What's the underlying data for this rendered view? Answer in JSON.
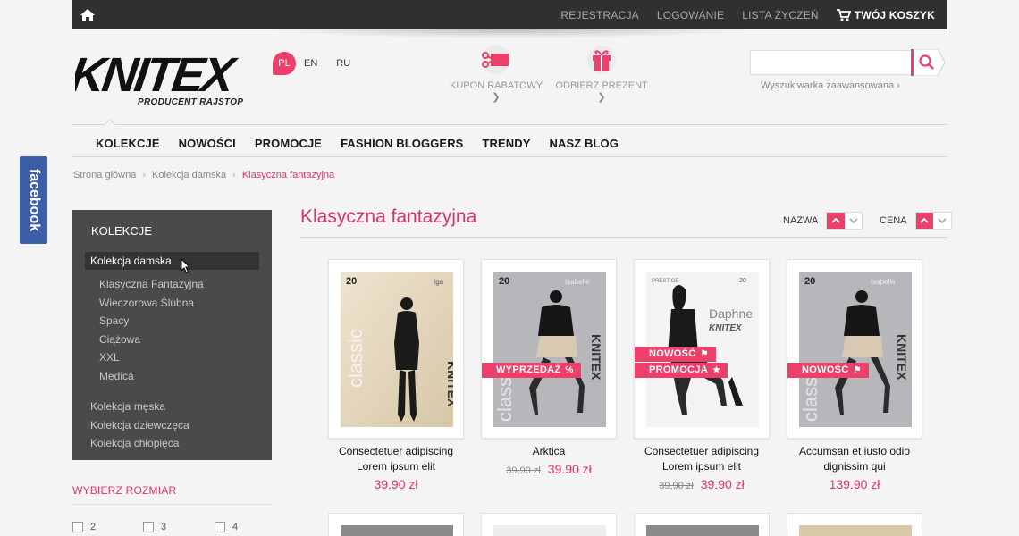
{
  "topbar": {
    "links": [
      "REJESTRACJA",
      "LOGOWANIE",
      "LISTA ŻYCZEŃ"
    ],
    "cart_label": "TWÓJ KOSZYK",
    "icons": {
      "home": "home-icon",
      "cart": "cart-icon"
    }
  },
  "header": {
    "logo_text": "KNITEX",
    "logo_sub": "PRODUCENT RAJSTOP",
    "languages": {
      "active": "PL",
      "others": [
        "EN",
        "RU"
      ]
    },
    "promos": {
      "coupon": "KUPON RABATOWY",
      "gift": "ODBIERZ PREZENT"
    },
    "search": {
      "value": "",
      "placeholder": "",
      "advanced": "Wyszukiwarka zaawansowana ›"
    }
  },
  "nav": [
    "KOLEKCJE",
    "NOWOŚCI",
    "PROMOCJE",
    "FASHION BLOGGERS",
    "TRENDY",
    "NASZ BLOG"
  ],
  "facebook_tab": "facebook",
  "breadcrumb": {
    "items": [
      "Strona główna",
      "Kolekcja damska"
    ],
    "current": "Klasyczna fantazyjna"
  },
  "sidebar": {
    "title": "KOLEKCJE",
    "active": "Kolekcja damska",
    "sub_items": [
      "Klasyczna Fantazyjna",
      "Wieczorowa Ślubna",
      "Spacy",
      "Ciążowa",
      "XXL",
      "Medica"
    ],
    "other_items": [
      "Kolekcja męska",
      "Kolekcja dziewczęca",
      "Kolekcja chłopięca"
    ]
  },
  "size_filter": {
    "title": "WYBIERZ ROZMIAR",
    "options": [
      "2",
      "3",
      "4"
    ]
  },
  "main": {
    "title": "Klasyczna fantazyjna",
    "sort": [
      "NAZWA",
      "CENA"
    ]
  },
  "products": [
    {
      "name_line1": "Consectetuer adipiscing",
      "name_line2": "Lorem ipsum elit",
      "old_price": "",
      "price": "39.90 zł",
      "badges": [],
      "package": {
        "den": "20",
        "brand": "Iga",
        "series": "classic"
      }
    },
    {
      "name_line1": "Arktica",
      "name_line2": "",
      "old_price": "39,90 zł",
      "price": "39.90 zł",
      "badges": [
        "WYPRZEDAŻ"
      ],
      "package": {
        "den": "20",
        "brand": "Isabelle",
        "series": "classic"
      }
    },
    {
      "name_line1": "Consectetuer adipiscing",
      "name_line2": "Lorem ipsum elit",
      "old_price": "39,90 zł",
      "price": "39.90 zł",
      "badges": [
        "NOWOŚĆ",
        "PROMOCJA"
      ],
      "package": {
        "den": "20",
        "brand": "Daphne",
        "series": ""
      }
    },
    {
      "name_line1": "Accumsan et iusto odio",
      "name_line2": "dignissim qui",
      "old_price": "",
      "price": "139.90 zł",
      "badges": [
        "NOWOŚĆ"
      ],
      "package": {
        "den": "20",
        "brand": "Isabelle",
        "series": "classic"
      }
    }
  ],
  "colors": {
    "accent": "#e0306a",
    "badge": "#ec3f6a",
    "topbar": "#303030",
    "sidebar": "#4a4a4a",
    "facebook": "#3b5ea6"
  }
}
